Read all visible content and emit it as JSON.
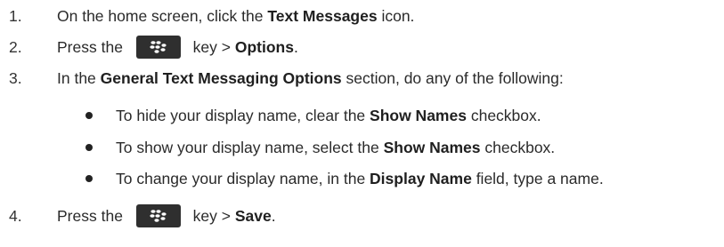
{
  "steps": [
    {
      "num": "1.",
      "pre": "On the home screen, click the ",
      "bold": "Text Messages",
      "post": " icon."
    },
    {
      "num": "2.",
      "pre": "Press the ",
      "key_icon": "blackberry-menu-key-icon",
      "mid": " key > ",
      "bold": "Options",
      "post": "."
    },
    {
      "num": "3.",
      "pre": "In the ",
      "bold": "General Text Messaging Options",
      "post": " section, do any of the following:"
    },
    {
      "num": "4.",
      "pre": "Press the ",
      "key_icon": "blackberry-menu-key-icon",
      "mid": " key > ",
      "bold": "Save",
      "post": "."
    }
  ],
  "bullets": [
    {
      "pre": "To hide your display name, clear the ",
      "bold": "Show Names",
      "post": " checkbox."
    },
    {
      "pre": "To show your display name, select the ",
      "bold": "Show Names",
      "post": " checkbox."
    },
    {
      "pre": "To change your display name, in the ",
      "bold": "Display Name",
      "post": " field, type a name."
    }
  ]
}
